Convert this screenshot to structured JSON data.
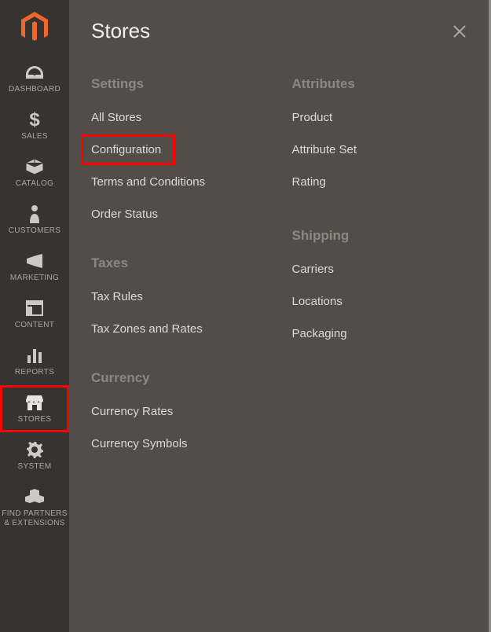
{
  "sidebar": {
    "items": [
      {
        "label": "DASHBOARD",
        "icon": "dashboard-icon"
      },
      {
        "label": "SALES",
        "icon": "dollar-icon"
      },
      {
        "label": "CATALOG",
        "icon": "box-icon"
      },
      {
        "label": "CUSTOMERS",
        "icon": "person-icon"
      },
      {
        "label": "MARKETING",
        "icon": "megaphone-icon"
      },
      {
        "label": "CONTENT",
        "icon": "layout-icon"
      },
      {
        "label": "REPORTS",
        "icon": "bars-icon"
      },
      {
        "label": "STORES",
        "icon": "store-icon",
        "active": true
      },
      {
        "label": "SYSTEM",
        "icon": "gear-icon"
      },
      {
        "label": "FIND PARTNERS & EXTENSIONS",
        "icon": "blocks-icon"
      }
    ]
  },
  "panel": {
    "title": "Stores",
    "columns": [
      {
        "sections": [
          {
            "heading": "Settings",
            "items": [
              {
                "label": "All Stores"
              },
              {
                "label": "Configuration",
                "highlighted": true
              },
              {
                "label": "Terms and Conditions"
              },
              {
                "label": "Order Status"
              }
            ]
          },
          {
            "heading": "Taxes",
            "items": [
              {
                "label": "Tax Rules"
              },
              {
                "label": "Tax Zones and Rates"
              }
            ]
          },
          {
            "heading": "Currency",
            "items": [
              {
                "label": "Currency Rates"
              },
              {
                "label": "Currency Symbols"
              }
            ]
          }
        ]
      },
      {
        "sections": [
          {
            "heading": "Attributes",
            "items": [
              {
                "label": "Product"
              },
              {
                "label": "Attribute Set"
              },
              {
                "label": "Rating"
              }
            ]
          },
          {
            "heading": "Shipping",
            "items": [
              {
                "label": "Carriers"
              },
              {
                "label": "Locations"
              },
              {
                "label": "Packaging"
              }
            ]
          }
        ]
      }
    ]
  },
  "colors": {
    "accent": "#ef672f",
    "sidebar_bg": "#373330",
    "panel_bg": "#524d49",
    "heading": "#8c877f",
    "link": "#dcdad6",
    "highlight": "#ff0000"
  }
}
